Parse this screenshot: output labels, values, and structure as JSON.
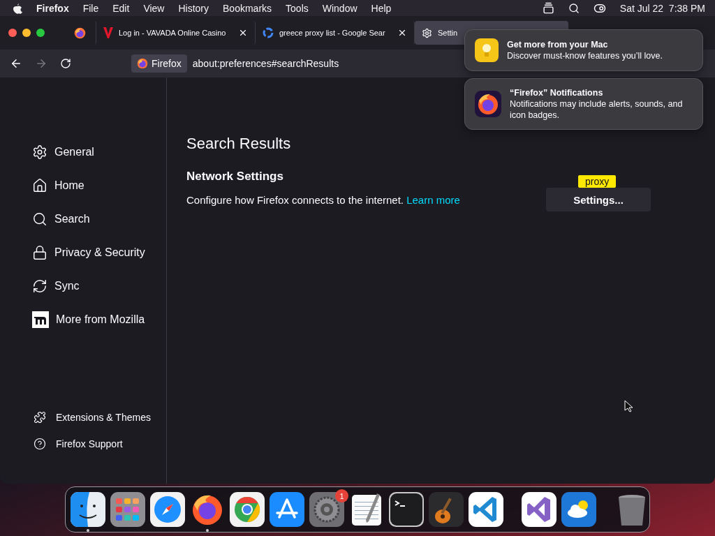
{
  "menu_bar": {
    "app": "Firefox",
    "menus": [
      "File",
      "Edit",
      "View",
      "History",
      "Bookmarks",
      "Tools",
      "Window",
      "Help"
    ],
    "clock": "Sat Jul 22  7:38 PM"
  },
  "tabs": [
    {
      "kind": "pinned",
      "selected": false
    },
    {
      "kind": "vavada",
      "title": "Log in - VAVADA Online Casino",
      "selected": false
    },
    {
      "kind": "google",
      "title": "greece proxy list - Google Sear",
      "selected": false
    },
    {
      "kind": "settings",
      "title": "Settin",
      "selected": true
    }
  ],
  "address_bar": {
    "identity": "Firefox",
    "url": "about:preferences#searchResults"
  },
  "sidebar": {
    "items": [
      {
        "kind": "gear",
        "label": "General"
      },
      {
        "kind": "home",
        "label": "Home"
      },
      {
        "kind": "search",
        "label": "Search"
      },
      {
        "kind": "lock",
        "label": "Privacy & Security"
      },
      {
        "kind": "sync",
        "label": "Sync"
      },
      {
        "kind": "mozilla",
        "label": "More from Mozilla"
      }
    ],
    "footer": [
      {
        "kind": "puzzle",
        "label": "Extensions & Themes"
      },
      {
        "kind": "help",
        "label": "Firefox Support"
      }
    ]
  },
  "content": {
    "heading": "Search Results",
    "section": "Network Settings",
    "description": "Configure how Firefox connects to the internet.",
    "link": "Learn more",
    "button": "Settings...",
    "highlight": "proxy"
  },
  "notifications": [
    {
      "kind": "tips",
      "title": "Get more from your Mac",
      "body": "Discover must-know features you’ll love."
    },
    {
      "kind": "firefox",
      "title": "“Firefox” Notifications",
      "body": "Notifications may include alerts, sounds, and icon badges."
    }
  ],
  "dock": {
    "apps": [
      {
        "kind": "finder",
        "running": true
      },
      {
        "kind": "launchpad",
        "running": false
      },
      {
        "kind": "safari",
        "running": false
      },
      {
        "kind": "firefox",
        "running": true
      },
      {
        "kind": "chrome",
        "running": false
      },
      {
        "kind": "appstore",
        "running": false
      },
      {
        "kind": "settings",
        "running": false,
        "badge": "1"
      },
      {
        "kind": "textedit",
        "running": false
      },
      {
        "kind": "terminal",
        "running": false
      },
      {
        "kind": "garageband",
        "running": false
      },
      {
        "kind": "vscode",
        "running": false
      },
      {
        "kind": "separator"
      },
      {
        "kind": "visualstudio",
        "running": false
      },
      {
        "kind": "weather",
        "running": false
      },
      {
        "kind": "separator"
      },
      {
        "kind": "trash",
        "running": false
      }
    ]
  }
}
